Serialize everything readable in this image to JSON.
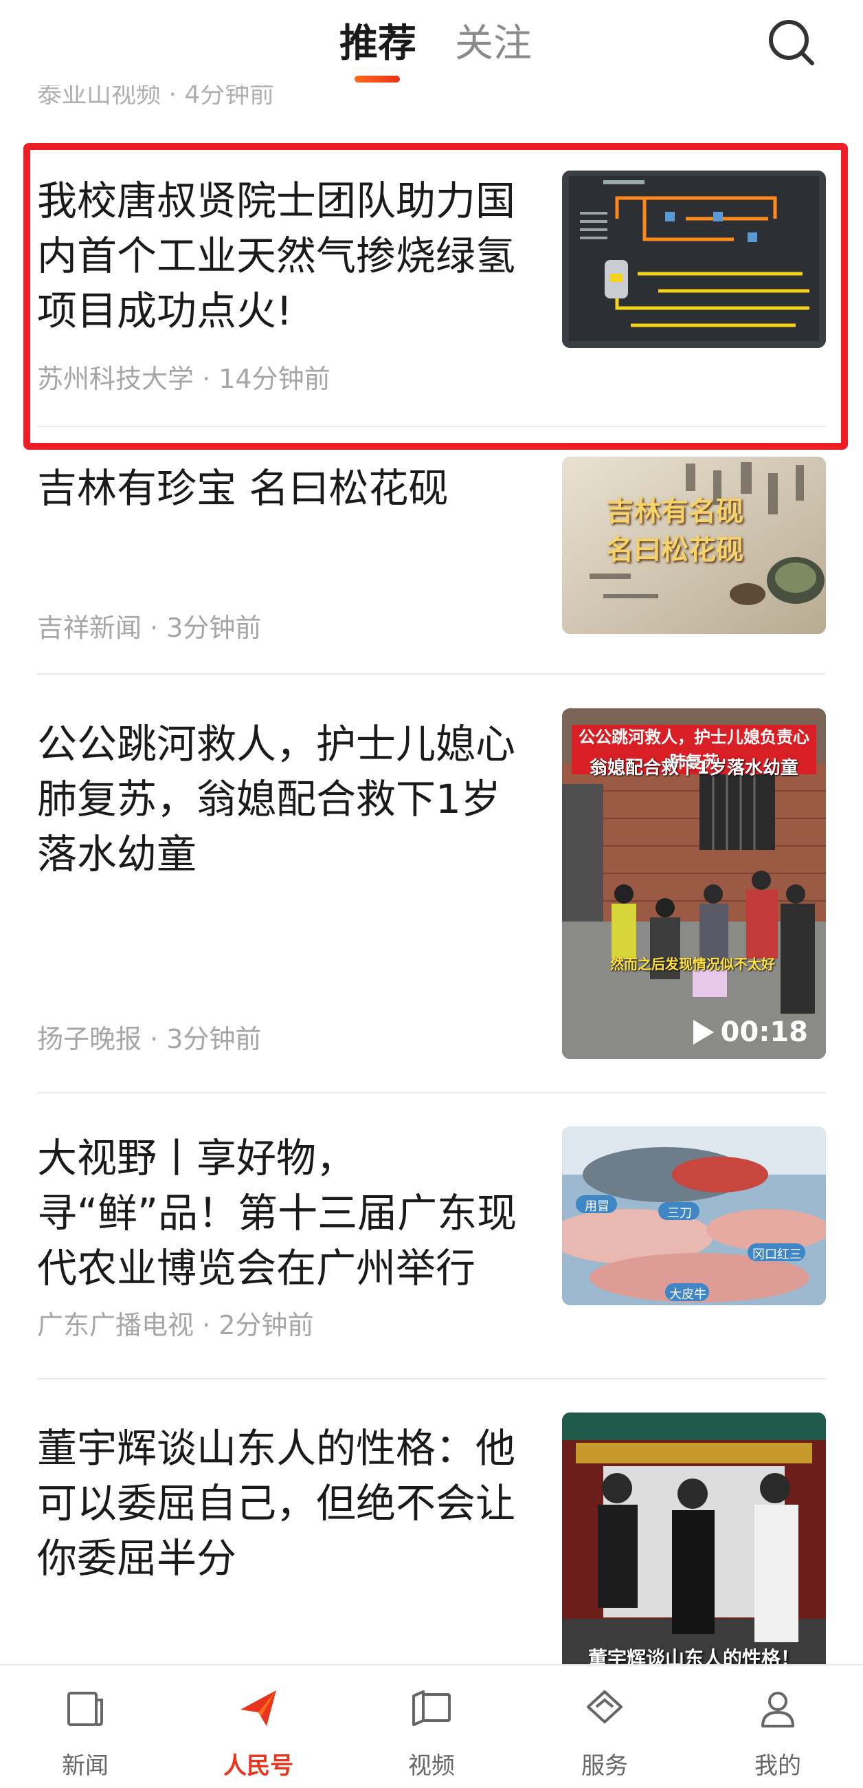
{
  "header": {
    "tabs": [
      {
        "label": "推荐",
        "active": true
      },
      {
        "label": "关注",
        "active": false
      }
    ],
    "search_icon": "search-icon"
  },
  "feed": {
    "previous_item_meta": "泰亚山视频 · 4分钟前",
    "items": [
      {
        "title": "我校唐叔贤院士团队助力国内首个工业天然气掺烧绿氢项目成功点火!",
        "meta": "苏州科技大学 · 14分钟前",
        "highlighted": true
      },
      {
        "title": "吉林有珍宝 名曰松花砚",
        "meta": "吉祥新闻 · 3分钟前",
        "thumb_text": [
          "吉林有名砚",
          "名曰松花砚"
        ]
      },
      {
        "title": "公公跳河救人，护士儿媳心肺复苏，翁媳配合救下1岁落水幼童",
        "meta": "扬子晚报 · 3分钟前",
        "thumb_caption_top": "公公跳河救人，护士儿媳负责心肺复苏",
        "thumb_caption_sub": "翁媳配合救下1岁落水幼童",
        "thumb_caption_bottom": "然而之后发现情况似不太好",
        "video_duration": "00:18"
      },
      {
        "title": "大视野丨享好物，寻“鲜”品！第十三届广东现代农业博览会在广州举行",
        "meta": "广东广播电视 · 2分钟前",
        "thumb_labels": [
          "三刀",
          "用冒",
          "冈口红三",
          "大皮牛"
        ]
      },
      {
        "title": "董宇辉谈山东人的性格：他可以委屈自己，但绝不会让你委屈半分",
        "thumb_caption": "董宇辉谈山东人的性格！"
      }
    ]
  },
  "bottom_nav": [
    {
      "label": "新闻",
      "icon": "news-icon",
      "active": false
    },
    {
      "label": "人民号",
      "icon": "paper-plane-icon",
      "active": true
    },
    {
      "label": "视频",
      "icon": "video-book-icon",
      "active": false
    },
    {
      "label": "服务",
      "icon": "service-diamond-icon",
      "active": false
    },
    {
      "label": "我的",
      "icon": "person-icon",
      "active": false
    }
  ],
  "colors": {
    "accent": "#e8341c",
    "highlight_border": "#ee1c24",
    "meta_text": "#a6a6a6"
  }
}
